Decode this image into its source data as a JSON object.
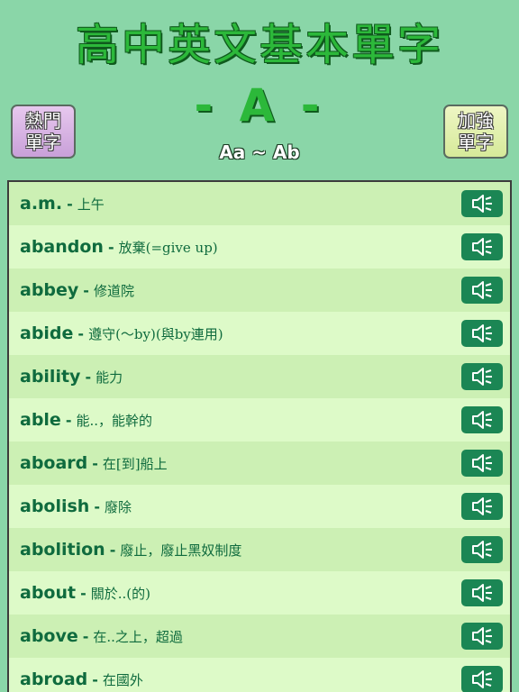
{
  "app_title": "高中英文基本單字",
  "left_button": {
    "line1": "熱門",
    "line2": "單字"
  },
  "right_button": {
    "line1": "加強",
    "line2": "單字"
  },
  "letter_heading": "- A -",
  "range_label": "Aa ~ Ab",
  "speaker_icon": "speaker-icon",
  "colors": {
    "background": "#8ad6a8",
    "title": "#2cb83a",
    "word": "#0f6b3e",
    "speaker": "#1b8654"
  },
  "words": [
    {
      "word": "a.m.",
      "meaning": "上午"
    },
    {
      "word": "abandon",
      "meaning": "放棄(=give up)"
    },
    {
      "word": "abbey",
      "meaning": "修道院"
    },
    {
      "word": "abide",
      "meaning": "遵守(～by)(與by連用)"
    },
    {
      "word": "ability",
      "meaning": "能力"
    },
    {
      "word": "able",
      "meaning": "能..，能幹的"
    },
    {
      "word": "aboard",
      "meaning": "在[到]船上"
    },
    {
      "word": "abolish",
      "meaning": "廢除"
    },
    {
      "word": "abolition",
      "meaning": "廢止，廢止黑奴制度"
    },
    {
      "word": "about",
      "meaning": "關於..(的)"
    },
    {
      "word": "above",
      "meaning": "在..之上，超過"
    },
    {
      "word": "abroad",
      "meaning": "在國外"
    }
  ]
}
